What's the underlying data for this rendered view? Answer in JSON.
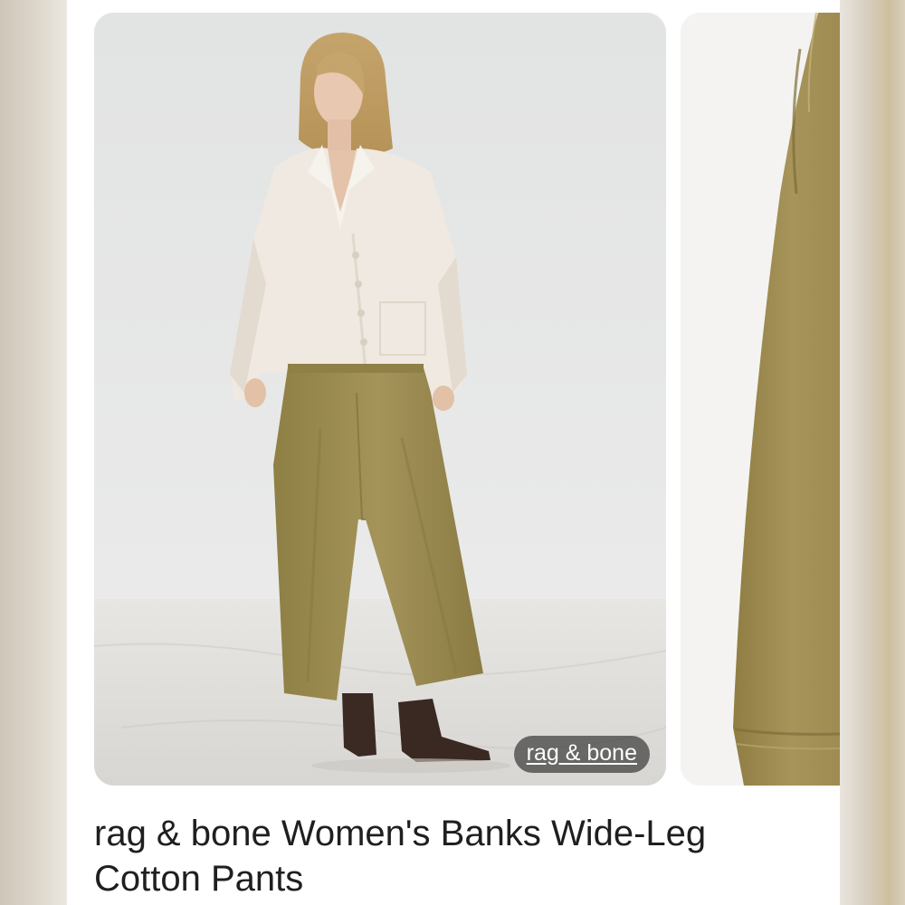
{
  "result_card": {
    "source_label": "rag & bone",
    "title": "rag & bone Women's Banks Wide-Leg Cotton Pants",
    "image_icon": "product-photo-model-wide-leg-pants"
  },
  "next_card": {
    "image_icon": "product-photo-pants-closeup"
  },
  "colors": {
    "page_background": "#ffffff",
    "title_text": "#1f1f1f",
    "badge_background": "#3c3c3c",
    "badge_text": "#ffffff",
    "pants_olive": "#9c8c4e",
    "sweater_cream": "#efe9e1",
    "studio_wall": "#e6e6e5"
  }
}
